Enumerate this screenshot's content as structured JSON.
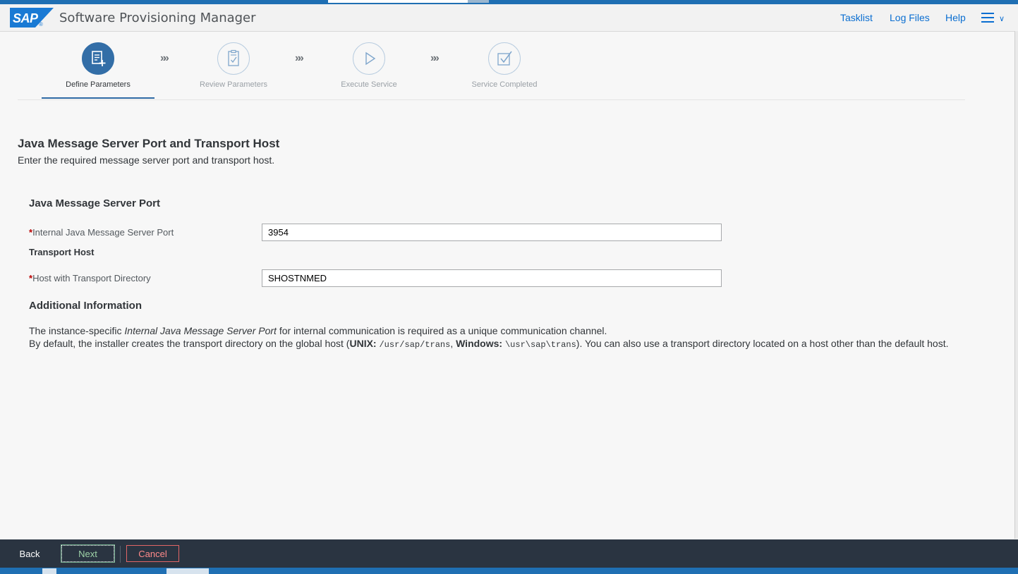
{
  "header": {
    "logo_text": "SAP",
    "logo_mark": "®",
    "title": "Software Provisioning Manager",
    "links": [
      "Tasklist",
      "Log Files",
      "Help"
    ],
    "menu_icon": "hamburger-icon",
    "menu_chevron": "∨"
  },
  "wizard": {
    "steps": [
      {
        "label": "Define Parameters",
        "icon": "form-add-icon",
        "state": "active"
      },
      {
        "label": "Review Parameters",
        "icon": "clipboard-check-icon",
        "state": "inactive"
      },
      {
        "label": "Execute Service",
        "icon": "play-icon",
        "state": "inactive"
      },
      {
        "label": "Service Completed",
        "icon": "checkbox-icon",
        "state": "inactive"
      }
    ],
    "separator": "»»"
  },
  "page": {
    "title": "Java Message Server Port and Transport Host",
    "subtitle": "Enter the required message server port and transport host."
  },
  "form": {
    "section_title": "Java Message Server Port",
    "required_marker": "*",
    "port_label": "Internal Java Message Server Port",
    "port_value": "3954",
    "transport_title": "Transport Host",
    "host_label": "Host with Transport Directory",
    "host_value": "SHOSTNMED"
  },
  "info": {
    "title": "Additional Information",
    "p1_a": "The instance-specific ",
    "p1_em": "Internal Java Message Server Port",
    "p1_b": " for internal communication is required as a unique communication channel.",
    "p2_a": "By default, the installer creates the transport directory on the global host (",
    "p2_unix": "UNIX:",
    "p2_unix_path": "/usr/sap/trans",
    "p2_sep": ", ",
    "p2_win": "Windows:",
    "p2_win_path": "\\usr\\sap\\trans",
    "p2_b": "). You can also use a transport directory located on a host other than the default host."
  },
  "footer": {
    "back": "Back",
    "next": "Next",
    "cancel": "Cancel"
  },
  "colors": {
    "accent": "#0a6ed1",
    "active_step": "#336ea7",
    "footer_bg": "#2a3441",
    "required": "#bb0000"
  }
}
